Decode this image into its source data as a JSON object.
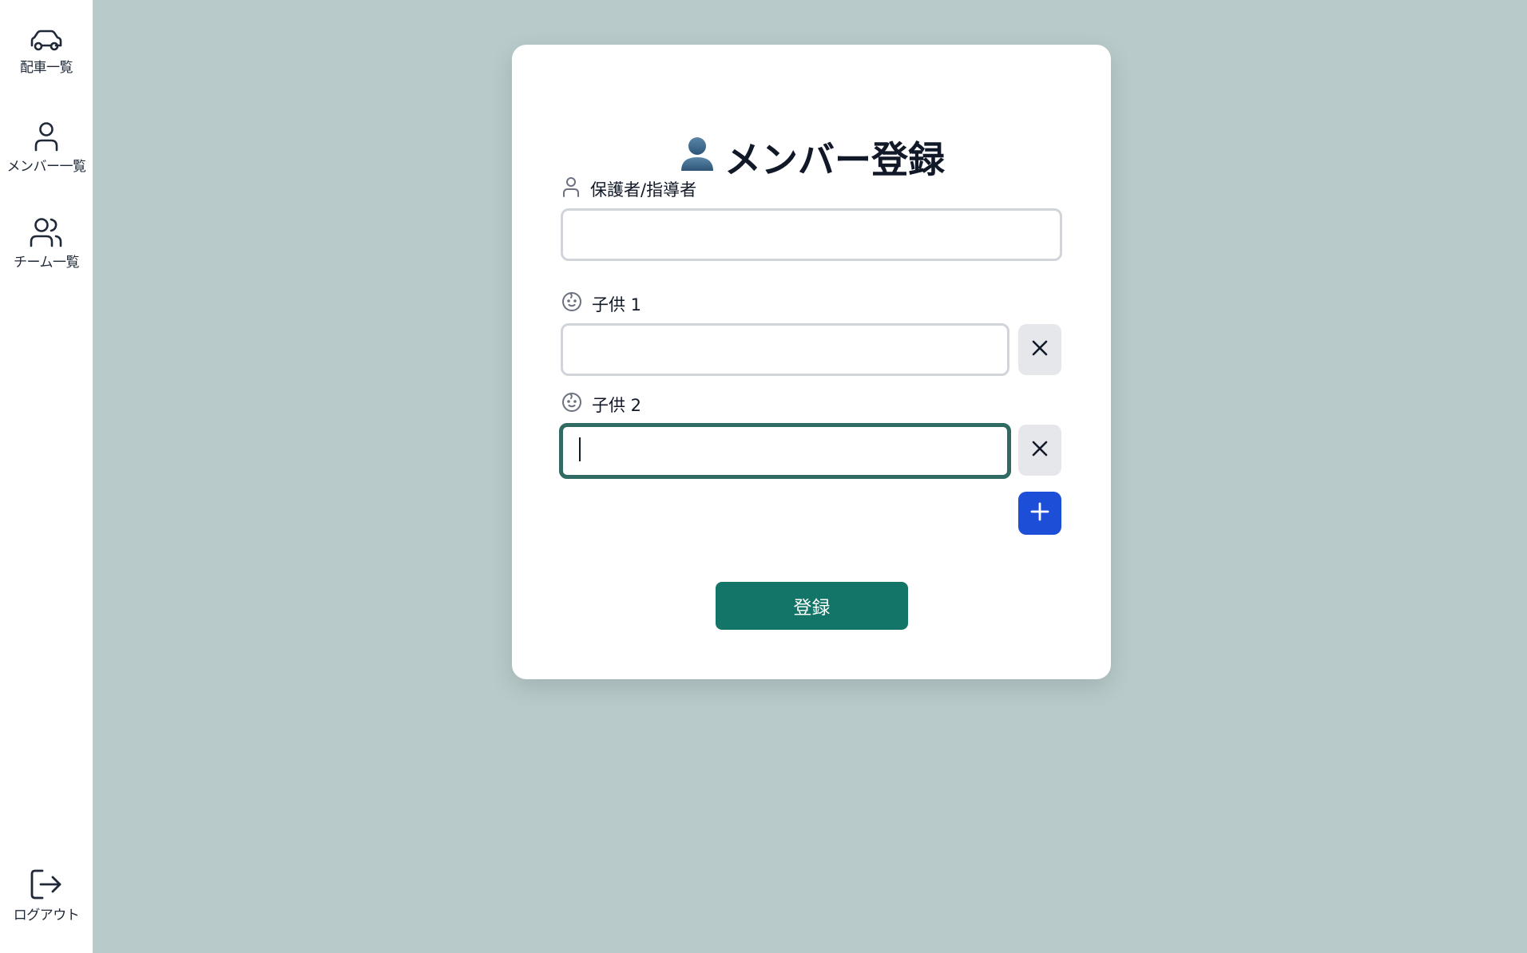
{
  "sidebar": {
    "items": [
      {
        "label": "配車一覧",
        "icon": "car-icon"
      },
      {
        "label": "メンバー一覧",
        "icon": "user-icon"
      },
      {
        "label": "チーム一覧",
        "icon": "users-icon"
      }
    ],
    "logout": {
      "label": "ログアウト",
      "icon": "logout-icon"
    }
  },
  "form": {
    "title": "メンバー登録",
    "title_icon": "person-silhouette-icon",
    "guardian": {
      "label": "保護者/指導者",
      "value": "",
      "icon": "user-icon"
    },
    "children": [
      {
        "label": "子供 1",
        "value": "",
        "icon": "baby-face-icon"
      },
      {
        "label": "子供 2",
        "value": "",
        "icon": "baby-face-icon",
        "focused": true
      }
    ],
    "remove_icon": "close-icon",
    "add_icon": "plus-icon",
    "submit_label": "登録"
  },
  "colors": {
    "background": "#b8caca",
    "primary": "#137567",
    "add_button": "#1d4ed8",
    "focus_border": "#2f6b63"
  }
}
